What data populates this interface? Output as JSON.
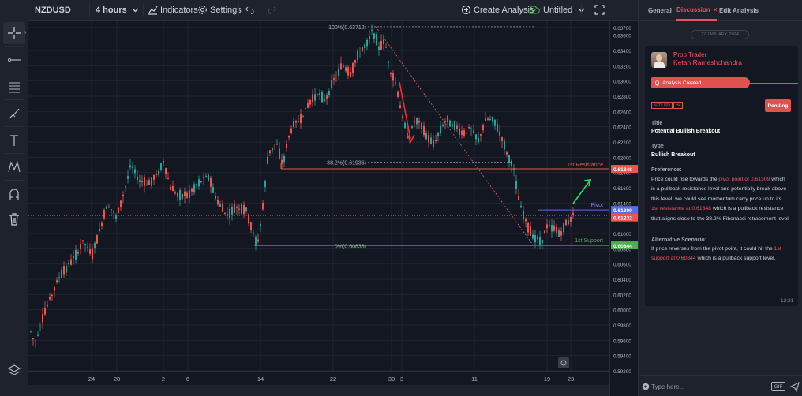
{
  "toolbar": {
    "symbol": "NZDUSD",
    "interval": "4 hours",
    "indicators_label": "Indicators",
    "settings_label": "Settings",
    "create_analysis_label": "Create Analysis",
    "layout_name": "Untitled"
  },
  "chart": {
    "price_ticks": [
      "0.63700",
      "0.63600",
      "0.63400",
      "0.63200",
      "0.63000",
      "0.62800",
      "0.62600",
      "0.62400",
      "0.62200",
      "0.62000",
      "0.61800",
      "0.61600",
      "0.61400",
      "0.61200",
      "0.61000",
      "0.60800",
      "0.60600",
      "0.60400",
      "0.60200",
      "0.60000",
      "0.59800",
      "0.59600",
      "0.59400",
      "0.59200"
    ],
    "date_ticks": [
      "24",
      "28",
      "2",
      "6",
      "14",
      "22",
      "30",
      "3",
      "11",
      "19",
      "23"
    ],
    "fib": {
      "level_100": "100%(0.63712)",
      "level_382": "38.2%(0.61936)",
      "level_0": "0%(0.60838)"
    },
    "levels": {
      "resistance_label": "1st Resistance",
      "resistance_price": "0.61848",
      "pivot_label": "Pivot",
      "pivot_price": "0.61309",
      "current_price": "0.61232",
      "support_label": "1st Support",
      "support_price": "0.60844"
    },
    "colors": {
      "up": "#26a69a",
      "down": "#ef5350",
      "resistance": "#ef5350",
      "pivot": "#5b6ee1",
      "support": "#4caf50"
    }
  },
  "panel": {
    "tabs": [
      "General",
      "Discussion",
      "Edit Analysis"
    ],
    "active_tab": "Discussion",
    "date_divider": "22 JANUARY, 2024",
    "author_role": "Prop Trader",
    "author_name": "Ketan Rameshchandra",
    "status": "Analysis Created",
    "symbol_chip": "NZDUSD",
    "timeframe_chip": "H4",
    "badge": "Pending",
    "title_label": "Title",
    "title_value": "Potential Bullish Breakout",
    "type_label": "Type",
    "type_value": "Bullish Breakout",
    "preference_label": "Preference:",
    "preference_parts": {
      "p1": "Price could rise towards the ",
      "h1": "pivot point of 0.61309",
      "p2": " which is a pullback resistance level and potentially break above this level; we could see momentum carry price up to its ",
      "h2": "1st resistance at 0.61848",
      "p3": " which is a pullback resistance that aligns close to the 38.2% Fibonacci retracement level."
    },
    "alt_label": "Alternative Scenario:",
    "alt_parts": {
      "p1": "If price reverses from the pivot point, it could hit the ",
      "h1": "1st support at 0.60844",
      "p2": " which is a pullback support level."
    },
    "message_time": "12:21",
    "composer_placeholder": "Type here...",
    "gif_label": "GIF"
  }
}
